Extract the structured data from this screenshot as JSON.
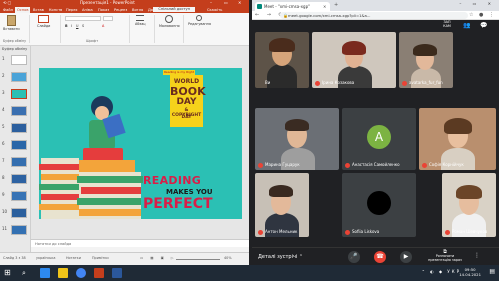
{
  "ppt": {
    "title": "Презентація1 - PowerPoint",
    "window_controls": [
      "–",
      "▭",
      "✕"
    ],
    "tabs": [
      "Файл",
      "Основне",
      "Вставлення",
      "Малювання",
      "Конструктор",
      "Переходи",
      "Анімація",
      "Показ слайдів",
      "Рецензування",
      "Вигляд",
      "Довідка"
    ],
    "tab_visible": [
      "Файл",
      "Основ",
      "Встав",
      "Конств",
      "Перех",
      "Аніма",
      "Показ",
      "Реценз",
      "Вигля",
      "Довід"
    ],
    "active_tab": "Основ",
    "search": "Скажіть",
    "share": "Спільний доступ",
    "ribbon": {
      "paste": "Вставити",
      "clipboard_label": "Буфер обміну",
      "slides": "Слайди",
      "font_label": "Шрифт",
      "paragraph": "Абзац",
      "drawing": "Малювання",
      "editing": "Редагування"
    },
    "thumb_header": "Буфер обміну",
    "slide_numbers": [
      "1",
      "2",
      "3",
      "4",
      "5",
      "6",
      "7",
      "8",
      "9",
      "10",
      "11"
    ],
    "notes": "Нотатки до слайда",
    "status": {
      "slide": "Слайд 3 з 38",
      "language": "українська",
      "notes_btn": "Нотатки",
      "comments_btn": "Примітки",
      "zoom": "40%"
    }
  },
  "slide": {
    "tag": "Reading is my Right",
    "world": "WORLD",
    "book": "BOOK",
    "day": "DAY",
    "copyright": "& COPYRIGHT",
    "day2": "DAY",
    "reading": "READING",
    "makes_you": "MAKES YOU",
    "perfect": "PERFECT"
  },
  "chrome": {
    "tab_title": "Meet - \"xmi-cmsa-xgp\"",
    "url": "meet.google.com/xmi-cmsa-xgp?pli=1&a...",
    "nav": "← → ⟳"
  },
  "meet": {
    "participants": [
      {
        "name": "Ви"
      },
      {
        "name": "Ірина Козакова"
      },
      {
        "name": "avatarka_fur_fun"
      },
      {
        "name": "Марина Гуцарук"
      },
      {
        "name": "Анастасія Самойленко"
      },
      {
        "name": "Софія Корнійчук"
      },
      {
        "name": "Антон Мельник"
      },
      {
        "name": "Sofiia Liskova"
      },
      {
        "name": "Роман Шевчуков"
      }
    ],
    "avatar_letter": "A",
    "details": "Деталі зустрічі",
    "present": "Розпочати презентацію зараз",
    "top_right_label": "ЗАП КАМ"
  },
  "taskbar": {
    "time": "09:50",
    "date": "14.04.2021",
    "lang": "УКР"
  },
  "colors": {
    "ppt_red": "#c43e1c",
    "slide_teal": "#2bc0b4",
    "banner_yellow": "#f6d21b",
    "reading_red": "#d91e48",
    "meet_bg": "#202124",
    "end_call": "#ea4335"
  }
}
